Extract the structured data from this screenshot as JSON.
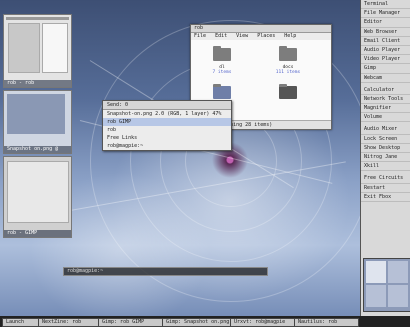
{
  "file_manager": {
    "title": "rob",
    "menu": [
      "File",
      "Edit",
      "View",
      "Places",
      "Help"
    ],
    "items": [
      {
        "name": "dl",
        "sub": "7 items"
      },
      {
        "name": "docs",
        "sub": "111 items"
      },
      {
        "name": "",
        "sub": ""
      },
      {
        "name": "",
        "sub": ""
      }
    ],
    "status": "cted (containing 28 items)"
  },
  "context_menu": {
    "title": "Send: 0",
    "items": [
      "Snapshot-on.png 2.0 (RGB, 1 layer) 47%",
      "rob GIMP",
      "rob",
      "Free Links",
      "rob@magpie:~"
    ],
    "selected_index": 1
  },
  "thumbnails": [
    {
      "label": "rob - rob"
    },
    {
      "label": "Snapshot on.png @"
    },
    {
      "label": "rob - GIMP"
    }
  ],
  "cmdline": {
    "text": "rob@magpie:~"
  },
  "right_menu": {
    "items": [
      "Terminal",
      "File Manager",
      "Editor",
      "Web Browser",
      "Email Client",
      "Audio Player",
      "Video Player",
      "Gimp",
      "Webcam",
      "Calculator",
      "Network Tools",
      "Magnifier",
      "Volume",
      "Audio Mixer",
      "Lock Screen",
      "Show Desktop",
      "Nitrog Jane",
      "Xkill",
      "Free Circuits",
      "Restart",
      "Exit Fbox"
    ]
  },
  "taskbar": {
    "items": [
      "Launch",
      "NextZine: rob",
      "Gimp: rob GIMP",
      "Gimp: Snapshot on.png",
      "Urxvt: rob@magpie",
      "Nautilus: rob"
    ]
  }
}
